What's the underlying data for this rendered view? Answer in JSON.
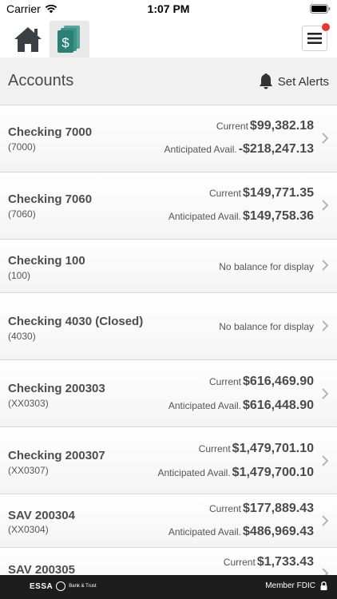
{
  "status_bar": {
    "carrier": "Carrier",
    "time": "1:07 PM"
  },
  "nav": {
    "home_icon": "home-icon",
    "accounts_icon": "money-icon",
    "menu_icon": "hamburger-icon"
  },
  "header": {
    "title": "Accounts",
    "alerts_label": "Set Alerts"
  },
  "accounts": [
    {
      "name": "Checking 7000",
      "number": "(7000)",
      "current_label": "Current",
      "current": "$99,382.18",
      "avail_label": "Anticipated Avail.",
      "avail": "-$218,247.13"
    },
    {
      "name": "Checking 7060",
      "number": "(7060)",
      "current_label": "Current",
      "current": "$149,771.35",
      "avail_label": "Anticipated Avail.",
      "avail": "$149,758.36"
    },
    {
      "name": "Checking 100",
      "number": "(100)",
      "no_balance": "No balance for display"
    },
    {
      "name": "Checking 4030 (Closed)",
      "number": "(4030)",
      "no_balance": "No balance for display"
    },
    {
      "name": "Checking 200303",
      "number": "(XX0303)",
      "current_label": "Current",
      "current": "$616,469.90",
      "avail_label": "Anticipated Avail.",
      "avail": "$616,448.90"
    },
    {
      "name": "Checking 200307",
      "number": "(XX0307)",
      "current_label": "Current",
      "current": "$1,479,701.10",
      "avail_label": "Anticipated Avail.",
      "avail": "$1,479,700.10"
    },
    {
      "name": "SAV 200304",
      "number": "(XX0304)",
      "current_label": "Current",
      "current": "$177,889.43",
      "avail_label": "Anticipated Avail.",
      "avail": "$486,969.43"
    },
    {
      "name": "SAV 200305",
      "number": "",
      "current_label": "Current",
      "current": "$1,733.43"
    }
  ],
  "footer": {
    "logo_word": "ESSA",
    "logo_tag": "Bank & Trust",
    "fdic_label": "Member FDIC"
  },
  "colors": {
    "accent_teal": "#2a7f76",
    "badge_red": "#e53935",
    "footer_bg": "#1d1d1d"
  }
}
